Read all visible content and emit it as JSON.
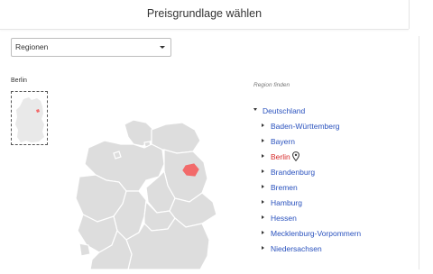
{
  "dialog": {
    "title": "Preisgrundlage wählen"
  },
  "region_select": {
    "value": "Regionen",
    "icon": "chevron-down-icon"
  },
  "map": {
    "selected_region": "Berlin",
    "colors": {
      "state_fill": "#dddddd",
      "state_border": "#ffffff",
      "highlight": "#f26a6a",
      "mini_fill": "#e9e9e9"
    }
  },
  "tree": {
    "search_label": "Region finden",
    "root": {
      "label": "Deutschland",
      "expanded": true
    },
    "items": [
      {
        "label": "Baden-Württemberg",
        "active": false
      },
      {
        "label": "Bayern",
        "active": false
      },
      {
        "label": "Berlin",
        "active": true,
        "icon": "map-pin-icon"
      },
      {
        "label": "Brandenburg",
        "active": false
      },
      {
        "label": "Bremen",
        "active": false
      },
      {
        "label": "Hamburg",
        "active": false
      },
      {
        "label": "Hessen",
        "active": false
      },
      {
        "label": "Mecklenburg-Vorpommern",
        "active": false
      },
      {
        "label": "Niedersachsen",
        "active": false
      }
    ],
    "colors": {
      "link": "#2a52be",
      "active": "#d62b2b"
    }
  }
}
